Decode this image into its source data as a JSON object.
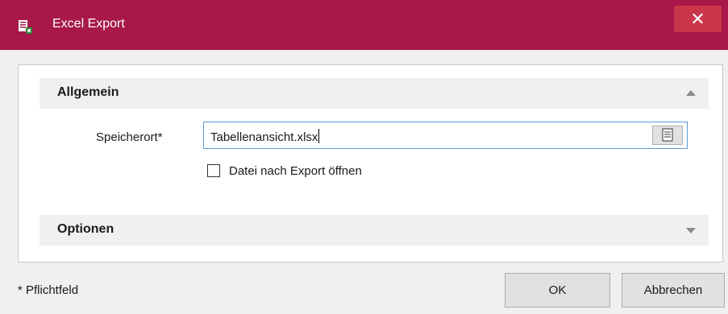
{
  "window": {
    "title": "Excel Export",
    "close_glyph": "✕",
    "accent": "#a8184a"
  },
  "sections": {
    "general": {
      "title": "Allgemein",
      "expanded": true
    },
    "options": {
      "title": "Optionen",
      "expanded": false
    }
  },
  "location": {
    "label": "Speicherort*",
    "value": "Tabellenansicht.xlsx",
    "browse_icon": "browse-list-icon"
  },
  "open_after_export": {
    "label": "Datei nach Export öffnen",
    "checked": false
  },
  "footer": {
    "required_note": "* Pflichtfeld",
    "ok_label": "OK",
    "cancel_label": "Abbrechen"
  }
}
